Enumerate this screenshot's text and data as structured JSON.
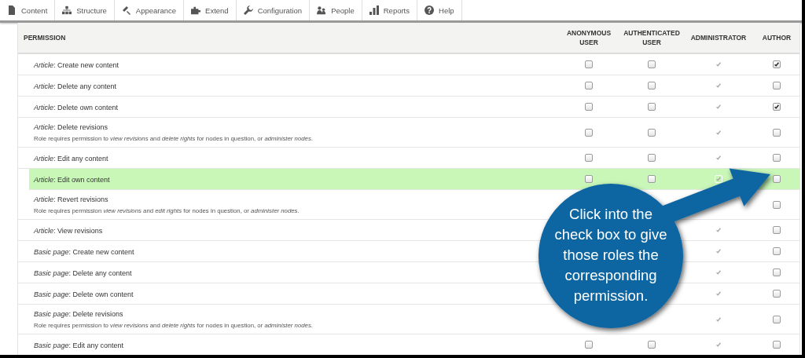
{
  "toolbar": [
    {
      "label": "Content"
    },
    {
      "label": "Structure"
    },
    {
      "label": "Appearance"
    },
    {
      "label": "Extend"
    },
    {
      "label": "Configuration"
    },
    {
      "label": "People"
    },
    {
      "label": "Reports"
    },
    {
      "label": "Help"
    }
  ],
  "table": {
    "columns": [
      "PERMISSION",
      "ANONYMOUS USER",
      "AUTHENTICATED USER",
      "ADMINISTRATOR",
      "AUTHOR"
    ],
    "rows": [
      {
        "title": "*Article*: Create new content",
        "highlighted": false,
        "cells": [
          {
            "checked": false,
            "disabled": false
          },
          {
            "checked": false,
            "disabled": false
          },
          {
            "checked": true,
            "disabled": true
          },
          {
            "checked": true,
            "disabled": false
          }
        ]
      },
      {
        "title": "*Article*: Delete any content",
        "highlighted": false,
        "cells": [
          {
            "checked": false,
            "disabled": false
          },
          {
            "checked": false,
            "disabled": false
          },
          {
            "checked": true,
            "disabled": true
          },
          {
            "checked": false,
            "disabled": false
          }
        ]
      },
      {
        "title": "*Article*: Delete own content",
        "highlighted": false,
        "cells": [
          {
            "checked": false,
            "disabled": false
          },
          {
            "checked": false,
            "disabled": false
          },
          {
            "checked": true,
            "disabled": true
          },
          {
            "checked": true,
            "disabled": false
          }
        ]
      },
      {
        "title": "*Article*: Delete revisions",
        "description": "Role requires permission to *view revisions* and *delete rights* for nodes in question, or *administer nodes*.",
        "highlighted": false,
        "cells": [
          {
            "checked": false,
            "disabled": false
          },
          {
            "checked": false,
            "disabled": false
          },
          {
            "checked": true,
            "disabled": true
          },
          {
            "checked": false,
            "disabled": false
          }
        ]
      },
      {
        "title": "*Article*: Edit any content",
        "highlighted": false,
        "cells": [
          {
            "checked": false,
            "disabled": false
          },
          {
            "checked": false,
            "disabled": false
          },
          {
            "checked": true,
            "disabled": true
          },
          {
            "checked": false,
            "disabled": false
          }
        ]
      },
      {
        "title": "*Article*: Edit own content",
        "highlighted": true,
        "cells": [
          {
            "checked": false,
            "disabled": false
          },
          {
            "checked": false,
            "disabled": false
          },
          {
            "checked": true,
            "disabled": true
          },
          {
            "checked": false,
            "disabled": false
          }
        ]
      },
      {
        "title": "*Article*: Revert revisions",
        "description": "Role requires permission *view revisions* and *edit rights* for nodes in question, or *administer nodes*.",
        "highlighted": false,
        "cells": [
          null,
          null,
          null,
          {
            "checked": false,
            "disabled": false
          }
        ]
      },
      {
        "title": "*Article*: View revisions",
        "highlighted": false,
        "cells": [
          null,
          null,
          {
            "checked": true,
            "disabled": true
          },
          {
            "checked": false,
            "disabled": false
          }
        ]
      },
      {
        "title": "*Basic page*: Create new content",
        "highlighted": false,
        "cells": [
          null,
          null,
          {
            "checked": true,
            "disabled": true
          },
          {
            "checked": false,
            "disabled": false
          }
        ]
      },
      {
        "title": "*Basic page*: Delete any content",
        "highlighted": false,
        "cells": [
          null,
          null,
          {
            "checked": true,
            "disabled": true
          },
          {
            "checked": false,
            "disabled": false
          }
        ]
      },
      {
        "title": "*Basic page*: Delete own content",
        "highlighted": false,
        "cells": [
          null,
          null,
          {
            "checked": true,
            "disabled": true
          },
          {
            "checked": false,
            "disabled": false
          }
        ]
      },
      {
        "title": "*Basic page*: Delete revisions",
        "description": "Role requires permission to *view revisions* and *delete rights* for nodes in question, or *administer nodes*.",
        "highlighted": false,
        "cells": [
          null,
          null,
          {
            "checked": true,
            "disabled": true
          },
          {
            "checked": false,
            "disabled": false
          }
        ]
      },
      {
        "title": "*Basic page*: Edit any content",
        "highlighted": false,
        "cells": [
          {
            "checked": false,
            "disabled": false
          },
          {
            "checked": false,
            "disabled": false
          },
          {
            "checked": true,
            "disabled": true
          },
          {
            "checked": false,
            "disabled": false
          }
        ]
      }
    ]
  },
  "callout": {
    "text": "Click into the check box to give those roles the corresponding permission."
  }
}
